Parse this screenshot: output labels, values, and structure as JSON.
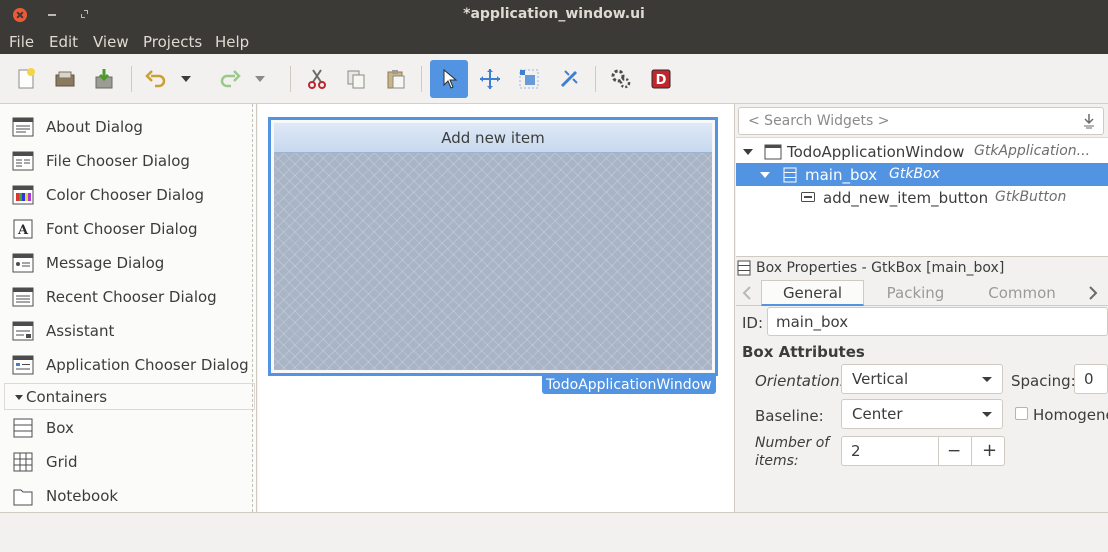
{
  "window": {
    "title": "*application_window.ui"
  },
  "menu": {
    "items": [
      "File",
      "Edit",
      "View",
      "Projects",
      "Help"
    ]
  },
  "toolbar": {
    "buttons": [
      "new-file-icon",
      "open-icon",
      "save-icon",
      "undo-icon",
      "undo-dropdown-icon",
      "redo-icon",
      "redo-dropdown-icon",
      "cut-icon",
      "copy-icon",
      "paste-icon",
      "select-pointer-icon",
      "drag-resize-icon",
      "margin-icon",
      "align-icon",
      "preferences-icon",
      "devhelp-icon"
    ],
    "active": "select-pointer-icon",
    "colors": {
      "active_bg": "#5294e2"
    }
  },
  "palette": {
    "items": [
      "About Dialog",
      "File Chooser Dialog",
      "Color Chooser Dialog",
      "Font Chooser Dialog",
      "Message Dialog",
      "Recent Chooser Dialog",
      "Assistant",
      "Application Chooser Dialog"
    ],
    "section": "Containers",
    "containers": [
      "Box",
      "Grid",
      "Notebook"
    ]
  },
  "canvas": {
    "button_label": "Add new item",
    "window_tag": "TodoApplicationWindow"
  },
  "inspector": {
    "search_placeholder": "< Search Widgets >",
    "tree": [
      {
        "name": "TodoApplicationWindow",
        "class": "GtkApplication..."
      },
      {
        "name": "main_box",
        "class": "GtkBox"
      },
      {
        "name": "add_new_item_button",
        "class": "GtkButton"
      }
    ],
    "selected": "main_box"
  },
  "properties": {
    "title": "Box Properties - GtkBox [main_box]",
    "tabs": [
      "General",
      "Packing",
      "Common"
    ],
    "active_tab": "General",
    "id_label": "ID:",
    "id_value": "main_box",
    "section": "Box Attributes",
    "orientation_label": "Orientation:",
    "orientation_value": "Vertical",
    "spacing_label": "Spacing:",
    "spacing_value": "0",
    "baseline_label": "Baseline:",
    "baseline_value": "Center",
    "homogeneous_label": "Homogene",
    "items_label_1": "Number of",
    "items_label_2": "items:",
    "items_value": "2",
    "minus": "−",
    "plus": "+"
  }
}
